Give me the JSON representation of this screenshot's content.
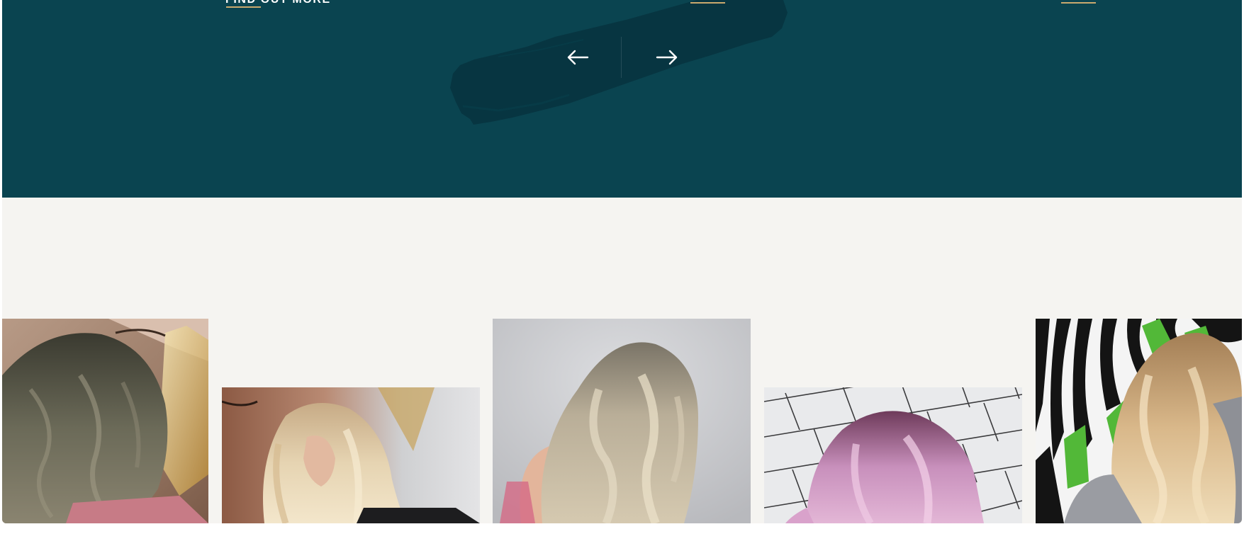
{
  "colors": {
    "hero_background": "#0a4450",
    "brush_stroke": "#073540",
    "accent": "#c9a96e",
    "gallery_background": "#f5f4f1",
    "arrow": "#ffffff"
  },
  "hero": {
    "cta_label": "FIND OUT MORE",
    "prev_icon": "arrow-left-icon",
    "next_icon": "arrow-right-icon"
  },
  "gallery": {
    "photos": [
      {
        "name": "ash-brown-waves"
      },
      {
        "name": "blonde-waves"
      },
      {
        "name": "silver-blonde-waves"
      },
      {
        "name": "pink-bob"
      },
      {
        "name": "honey-blonde-curls"
      }
    ]
  }
}
